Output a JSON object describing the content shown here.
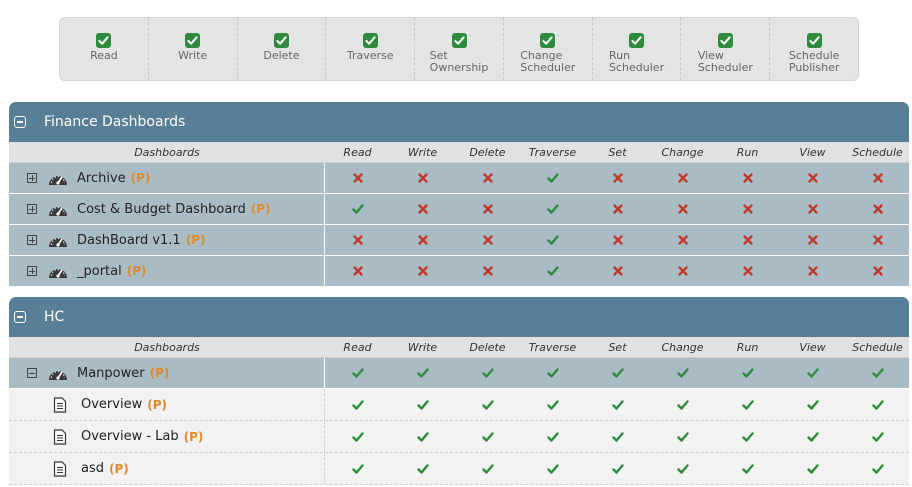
{
  "legend": [
    {
      "label": "Read",
      "icon": "check-box-icon"
    },
    {
      "label": "Write",
      "icon": "check-box-icon"
    },
    {
      "label": "Delete",
      "icon": "check-box-icon"
    },
    {
      "label": "Traverse",
      "icon": "check-box-icon"
    },
    {
      "label": "Set\nOwnership",
      "icon": "check-box-icon"
    },
    {
      "label": "Change\nScheduler",
      "icon": "check-box-icon"
    },
    {
      "label": "Run\nScheduler",
      "icon": "check-box-icon"
    },
    {
      "label": "View\nScheduler",
      "icon": "check-box-icon"
    },
    {
      "label": "Schedule\nPublisher",
      "icon": "check-box-icon"
    }
  ],
  "columns": {
    "name": "Dashboards",
    "perms": [
      "Read",
      "Write",
      "Delete",
      "Traverse",
      "Set",
      "Change",
      "Run",
      "View",
      "Schedule"
    ]
  },
  "colors": {
    "header": "#587f96",
    "check": "#2e8b3e",
    "cross": "#c0392b",
    "p_tag": "#e08a2a"
  },
  "groups": [
    {
      "title": "Finance Dashboards",
      "rows": [
        {
          "kind": "dash",
          "expander": "plus",
          "name": "Archive",
          "tag": "(P)",
          "perms": [
            0,
            0,
            0,
            1,
            0,
            0,
            0,
            0,
            0
          ]
        },
        {
          "kind": "dash",
          "expander": "plus",
          "name": "Cost & Budget Dashboard",
          "tag": "(P)",
          "perms": [
            1,
            0,
            0,
            1,
            0,
            0,
            0,
            0,
            0
          ]
        },
        {
          "kind": "dash",
          "expander": "plus",
          "name": "DashBoard v1.1",
          "tag": "(P)",
          "perms": [
            0,
            0,
            0,
            1,
            0,
            0,
            0,
            0,
            0
          ]
        },
        {
          "kind": "dash",
          "expander": "plus",
          "name": "_portal",
          "tag": "(P)",
          "perms": [
            0,
            0,
            0,
            1,
            0,
            0,
            0,
            0,
            0
          ]
        }
      ]
    },
    {
      "title": "HC",
      "rows": [
        {
          "kind": "dash",
          "expander": "minus",
          "name": "Manpower",
          "tag": "(P)",
          "perms": [
            1,
            1,
            1,
            1,
            1,
            1,
            1,
            1,
            1
          ]
        },
        {
          "kind": "sub",
          "name": "Overview",
          "tag": "(P)",
          "perms": [
            1,
            1,
            1,
            1,
            1,
            1,
            1,
            1,
            1
          ]
        },
        {
          "kind": "sub",
          "name": "Overview - Lab",
          "tag": "(P)",
          "perms": [
            1,
            1,
            1,
            1,
            1,
            1,
            1,
            1,
            1
          ]
        },
        {
          "kind": "sub",
          "name": "asd",
          "tag": "(P)",
          "perms": [
            1,
            1,
            1,
            1,
            1,
            1,
            1,
            1,
            1
          ]
        }
      ]
    }
  ]
}
